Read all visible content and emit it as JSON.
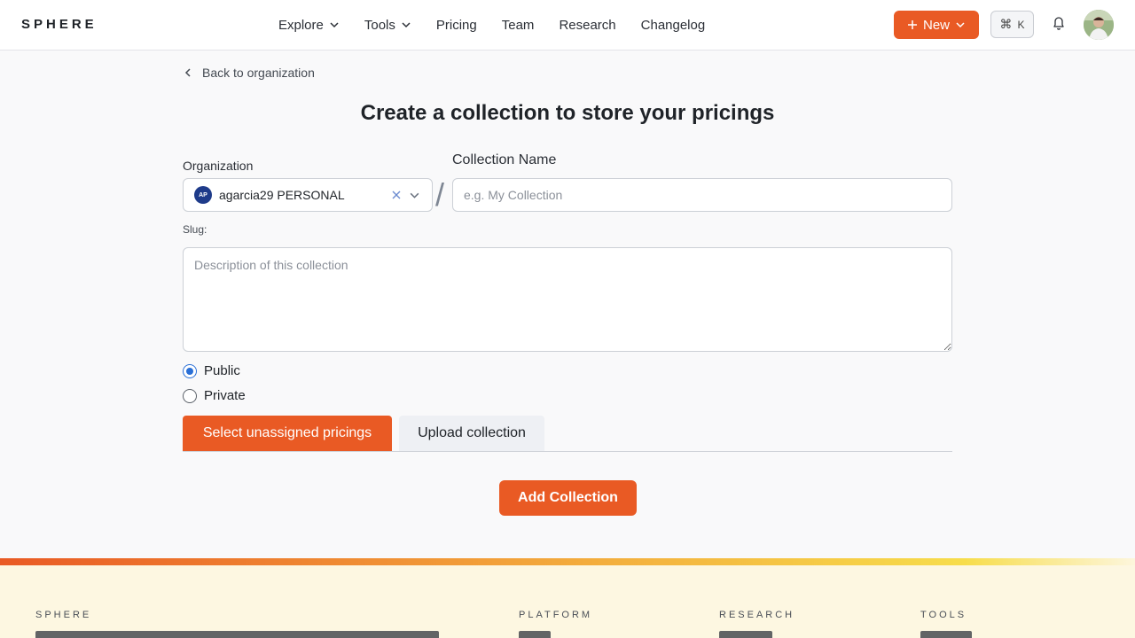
{
  "header": {
    "logo": "SPHERE",
    "nav": [
      {
        "label": "Explore",
        "dropdown": true
      },
      {
        "label": "Tools",
        "dropdown": true
      },
      {
        "label": "Pricing",
        "dropdown": false
      },
      {
        "label": "Team",
        "dropdown": false
      },
      {
        "label": "Research",
        "dropdown": false
      },
      {
        "label": "Changelog",
        "dropdown": false
      }
    ],
    "new_button": "New",
    "shortcut_key": "K",
    "accent": "#e95a24"
  },
  "back_link": "Back to organization",
  "page_title": "Create a collection to store your pricings",
  "form": {
    "organization_label": "Organization",
    "organization_badge": "AP",
    "organization_value": "agarcia29 PERSONAL",
    "separator": "/",
    "collection_label": "Collection Name",
    "collection_placeholder": "e.g. My Collection",
    "slug_label": "Slug:",
    "description_placeholder": "Description of this collection",
    "visibility": [
      {
        "label": "Public",
        "checked": true
      },
      {
        "label": "Private",
        "checked": false
      }
    ],
    "tabs": [
      {
        "label": "Select unassigned pricings",
        "active": true
      },
      {
        "label": "Upload collection",
        "active": false
      }
    ],
    "submit": "Add Collection"
  },
  "footer": {
    "brand": "SPHERE",
    "columns": [
      "PLATFORM",
      "RESEARCH",
      "TOOLS"
    ]
  }
}
